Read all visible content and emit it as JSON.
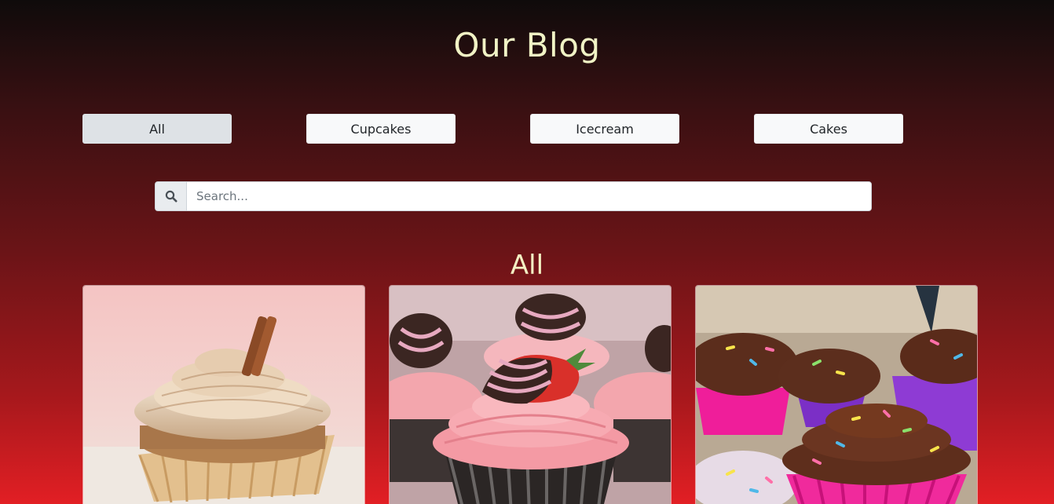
{
  "page": {
    "title": "Our Blog"
  },
  "filters": [
    {
      "label": "All",
      "active": true
    },
    {
      "label": "Cupcakes",
      "active": false
    },
    {
      "label": "Icecream",
      "active": false
    },
    {
      "label": "Cakes",
      "active": false
    }
  ],
  "search": {
    "icon": "search-icon",
    "placeholder": "Search...",
    "value": ""
  },
  "section": {
    "title": "All"
  },
  "cards": [
    {
      "image": "cinnamon-cupcake-photo"
    },
    {
      "image": "strawberry-chocolate-cupcake-photo"
    },
    {
      "image": "sprinkle-chocolate-cupcake-photo"
    }
  ],
  "colors": {
    "title_text": "#f1f3c5",
    "button_bg": "#f8f9fa",
    "button_active_bg": "#dee2e6",
    "gradient_top": "#0f0b0b",
    "gradient_bottom": "#e21f24"
  }
}
